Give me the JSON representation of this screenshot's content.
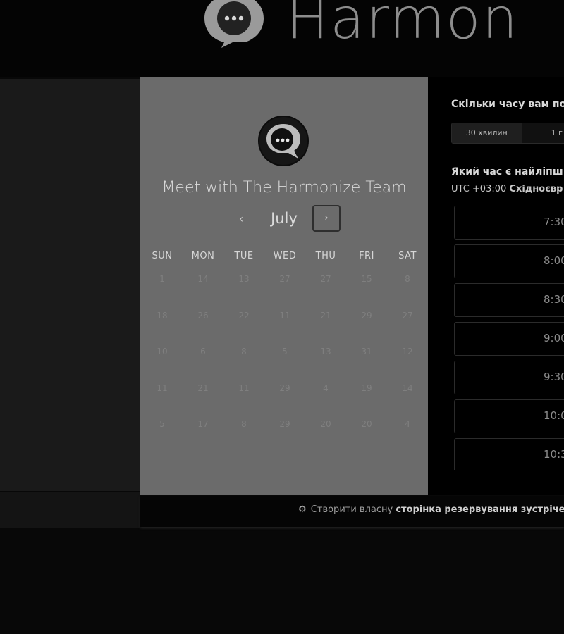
{
  "brand": {
    "name": "Harmon"
  },
  "calendar": {
    "title": "Meet with The Harmonize Team",
    "month": "July",
    "prev_icon": "chevron-left-icon",
    "next_icon": "chevron-right-icon",
    "prev_symbol": "‹",
    "next_symbol": "›",
    "weekdays": [
      "SUN",
      "MON",
      "TUE",
      "WED",
      "THU",
      "FRI",
      "SAT"
    ],
    "weeks": [
      [
        "1",
        "14",
        "13",
        "27",
        "27",
        "15",
        "8"
      ],
      [
        "18",
        "26",
        "22",
        "11",
        "21",
        "29",
        "27"
      ],
      [
        "10",
        "6",
        "8",
        "5",
        "13",
        "31",
        "12"
      ],
      [
        "11",
        "21",
        "11",
        "29",
        "4",
        "19",
        "14"
      ],
      [
        "5",
        "17",
        "8",
        "29",
        "20",
        "20",
        "4"
      ]
    ]
  },
  "booking": {
    "duration_question": "Скільки часу вам по",
    "duration_options": [
      "30 хвилин",
      "1 г"
    ],
    "time_question": "Який час є найліпш",
    "timezone_offset": "UTC +03:00",
    "timezone_name": "Східноєвр",
    "slots": [
      "7:30",
      "8:00",
      "8:30",
      "9:00",
      "9:30",
      "10:0",
      "10:3"
    ]
  },
  "footer": {
    "icon": "hubspot-sprocket-icon",
    "symbol": "⚙",
    "prefix": "Створити власну",
    "link": "сторінка резервування зустрічей"
  },
  "colors": {
    "page_bg": "#080808",
    "calendar_panel": "#6b6b6b",
    "side_panel": "#1a1a1a",
    "right_panel": "#000000",
    "brand_text": "#8d8d8d"
  }
}
